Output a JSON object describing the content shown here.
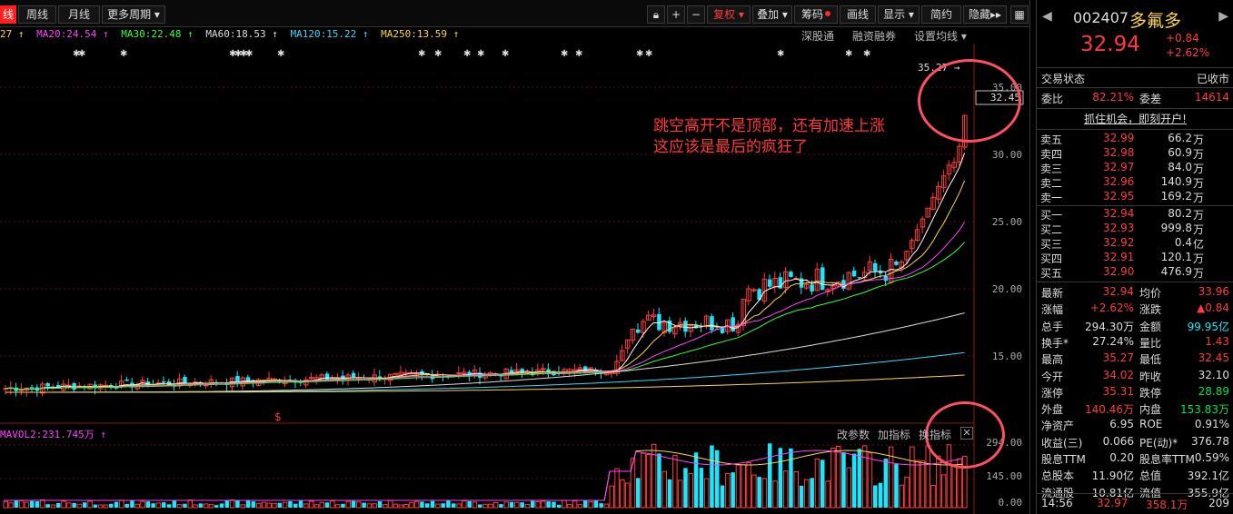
{
  "toolbar": {
    "first_tab": "线",
    "week": "周线",
    "month": "月线",
    "more_period": "更多周期",
    "fuquan": "复权",
    "overlay": "叠加",
    "chips": "筹码",
    "draw": "画线",
    "display": "显示",
    "simple": "简约",
    "hide": "隐藏",
    "hide_arrow": "▸▸"
  },
  "ma_line": [
    {
      "text": "27 ↑",
      "color": "#ffd54a"
    },
    {
      "text": "MA20:24.54 ↑",
      "color": "#ff40ff"
    },
    {
      "text": "MA30:22.48 ↑",
      "color": "#33ff33"
    },
    {
      "text": "MA60:18.53 ↑",
      "color": "#dddddd"
    },
    {
      "text": "MA120:15.22 ↑",
      "color": "#3ad6ff"
    },
    {
      "text": "MA250:13.59 ↑",
      "color": "#ffd54a"
    }
  ],
  "mid_links": {
    "a": "深股通",
    "b": "融资融券",
    "c": "设置均线",
    "caret": "▾"
  },
  "price_axis": [
    "35.00",
    "30.00",
    "25.00",
    "20.00",
    "15.00"
  ],
  "current_price_tag": "32.45",
  "high_mark": "35.27",
  "dollar_mark": "$",
  "annotation": {
    "line1": "跳空高开不是顶部，还有加速上涨",
    "line2": "这应该是最后的疯狂了"
  },
  "vol": {
    "label": "MAVOL2:231.745万 ↑",
    "add_indicator": "改参数",
    "add2": "加指标",
    "switch": "换指标",
    "axis": [
      "294.00",
      "145.00",
      "0.00"
    ]
  },
  "stock": {
    "code": "002407",
    "name": "多氟多",
    "price": "32.94",
    "change": "+0.84",
    "change_pct": "+2.62%"
  },
  "trade_status": {
    "label": "交易状态",
    "value": "已收市"
  },
  "weibi": {
    "label": "委比",
    "value": "82.21%",
    "label2": "委差",
    "value2": "14614"
  },
  "promo": "抓住机会，即刻开户!",
  "sell_orders": [
    {
      "label": "卖五",
      "price": "32.99",
      "vol": "66.2",
      "unit": "万"
    },
    {
      "label": "卖四",
      "price": "32.98",
      "vol": "60.9",
      "unit": "万"
    },
    {
      "label": "卖三",
      "price": "32.97",
      "vol": "84.0",
      "unit": "万"
    },
    {
      "label": "卖二",
      "price": "32.96",
      "vol": "140.9",
      "unit": "万"
    },
    {
      "label": "卖一",
      "price": "32.95",
      "vol": "169.2",
      "unit": "万"
    }
  ],
  "buy_orders": [
    {
      "label": "买一",
      "price": "32.94",
      "vol": "80.2",
      "unit": "万"
    },
    {
      "label": "买二",
      "price": "32.93",
      "vol": "999.8",
      "unit": "万"
    },
    {
      "label": "买三",
      "price": "32.92",
      "vol": "0.4",
      "unit": "亿"
    },
    {
      "label": "买四",
      "price": "32.91",
      "vol": "120.1",
      "unit": "万"
    },
    {
      "label": "买五",
      "price": "32.90",
      "vol": "476.9",
      "unit": "万"
    }
  ],
  "stats": [
    {
      "l1": "最新",
      "v1": "32.94",
      "c1": "red",
      "l2": "均价",
      "v2": "33.96",
      "c2": "red"
    },
    {
      "l1": "涨幅",
      "v1": "+2.62%",
      "c1": "red",
      "l2": "涨跌",
      "v2": "▲0.84",
      "c2": "red"
    },
    {
      "l1": "总手",
      "v1": "294.30万",
      "c1": "white",
      "l2": "金额",
      "v2": "99.95亿",
      "c2": "cyan"
    },
    {
      "l1": "换手*",
      "v1": "27.24%",
      "c1": "white",
      "l2": "量比",
      "v2": "1.43",
      "c2": "red"
    },
    {
      "l1": "最高",
      "v1": "35.27",
      "c1": "red",
      "l2": "最低",
      "v2": "32.45",
      "c2": "red"
    },
    {
      "l1": "今开",
      "v1": "34.02",
      "c1": "red",
      "l2": "昨收",
      "v2": "32.10",
      "c2": "white"
    },
    {
      "l1": "涨停",
      "v1": "35.31",
      "c1": "red",
      "l2": "跌停",
      "v2": "28.89",
      "c2": "green"
    },
    {
      "l1": "外盘",
      "v1": "140.46万",
      "c1": "red",
      "l2": "内盘",
      "v2": "153.83万",
      "c2": "green"
    },
    {
      "l1": "净资产",
      "v1": "6.95",
      "c1": "white",
      "l2": "ROE",
      "v2": "0.91%",
      "c2": "white"
    },
    {
      "l1": "收益(三)",
      "v1": "0.066",
      "c1": "white",
      "l2": "PE(动)*",
      "v2": "376.78",
      "c2": "white"
    },
    {
      "l1": "股息TTM",
      "v1": "0.20",
      "c1": "white",
      "l2": "股息率TTM",
      "v2": "0.59%",
      "c2": "white"
    },
    {
      "l1": "总股本",
      "v1": "11.90亿",
      "c1": "white",
      "l2": "总值",
      "v2": "392.1亿",
      "c2": "white"
    },
    {
      "l1": "流通股",
      "v1": "10.81亿",
      "c1": "white",
      "l2": "流值",
      "v2": "355.9亿",
      "c2": "white"
    }
  ],
  "tick": {
    "time": "14:56",
    "price": "32.97",
    "vol": "358.1万",
    "count": "209"
  }
}
